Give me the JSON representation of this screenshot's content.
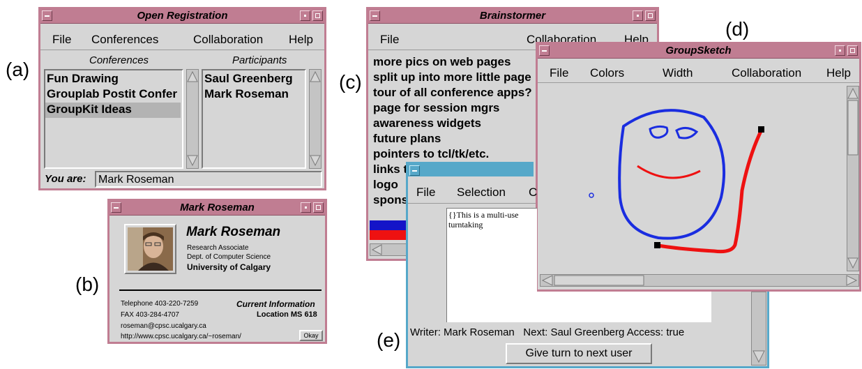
{
  "labels": {
    "a": "(a)",
    "b": "(b)",
    "c": "(c)",
    "d": "(d)",
    "e": "(e)"
  },
  "open_registration": {
    "title": "Open Registration",
    "menu": [
      "File",
      "Conferences",
      "Collaboration",
      "Help"
    ],
    "conferences_header": "Conferences",
    "participants_header": "Participants",
    "conferences": [
      "Fun Drawing",
      "Grouplab Postit Confer",
      "GroupKit Ideas"
    ],
    "selected_index": 2,
    "participants": [
      "Saul Greenberg",
      "Mark Roseman"
    ],
    "you_are_label": "You are:",
    "you_are_value": "Mark Roseman"
  },
  "business_card": {
    "title": "Mark Roseman",
    "name": "Mark Roseman",
    "position": "Research Associate",
    "department": "Dept. of Computer Science",
    "university": "University of Calgary",
    "telephone": "Telephone 403-220-7259",
    "fax": "FAX 403-284-4707",
    "email": "roseman@cpsc.ucalgary.ca",
    "url": "http://www.cpsc.ucalgary.ca/~roseman/",
    "current_info": "Current Information",
    "location": "Location MS 618",
    "okay": "Okay"
  },
  "brainstormer": {
    "title": "Brainstormer",
    "menu": [
      "File",
      "Collaboration",
      "Help"
    ],
    "ideas": [
      "more pics on web pages",
      "split up into more little page",
      "tour of all conference apps?",
      "page for session mgrs",
      "awareness widgets",
      "future plans",
      "pointers to tcl/tk/etc.",
      "links t",
      "logo",
      "spons"
    ]
  },
  "groupsketch": {
    "title": "GroupSketch",
    "menu": [
      "File",
      "Colors",
      "Width",
      "Collaboration",
      "Help"
    ],
    "colors": {
      "blue": "#1a2de0",
      "red": "#ee1111",
      "bg": "#d6d6d6"
    }
  },
  "writer": {
    "menu": [
      "File",
      "Selection",
      "C"
    ],
    "text_line1": "{}This is a multi-use",
    "text_line2": "turntaking",
    "status_writer": "Writer: Mark Roseman",
    "status_next": "Next: Saul Greenberg",
    "status_access": "Access: true",
    "give_turn": "Give turn to next user"
  }
}
